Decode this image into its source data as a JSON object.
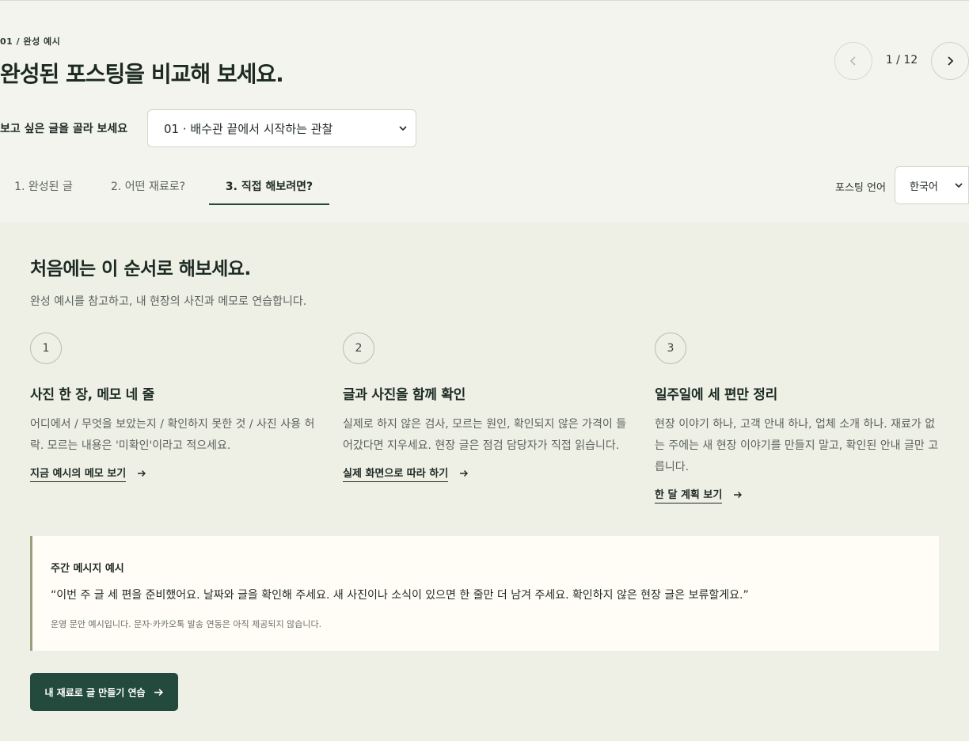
{
  "header": {
    "eyebrow": "01 / 완성 예시",
    "title": "완성된 포스팅을 비교해 보세요.",
    "pager": {
      "count": "1 / 12"
    },
    "picker": {
      "label": "보고 싶은 글을 골라 보세요",
      "selected": "01 · 배수관 끝에서 시작하는 관찰"
    }
  },
  "tabs": [
    {
      "label": "1. 완성된 글"
    },
    {
      "label": "2. 어떤 재료로?"
    },
    {
      "label": "3. 직접 해보려면?",
      "active": true
    }
  ],
  "language": {
    "label": "포스팅 언어",
    "selected": "한국어"
  },
  "section": {
    "title": "처음에는 이 순서로 해보세요.",
    "subtitle": "완성 예시를 참고하고, 내 현장의 사진과 메모로 연습합니다."
  },
  "steps": [
    {
      "num": "1",
      "title": "사진 한 장, 메모 네 줄",
      "desc": "어디에서 / 무엇을 보았는지 / 확인하지 못한 것 / 사진 사용 허락. 모르는 내용은 '미확인'이라고 적으세요.",
      "link": "지금 예시의 메모 보기"
    },
    {
      "num": "2",
      "title": "글과 사진을 함께 확인",
      "desc": "실제로 하지 않은 검사, 모르는 원인, 확인되지 않은 가격이 들어갔다면 지우세요. 현장 글은 점검 담당자가 직접 읽습니다.",
      "link": "실제 화면으로 따라 하기"
    },
    {
      "num": "3",
      "title": "일주일에 세 편만 정리",
      "desc": "현장 이야기 하나, 고객 안내 하나, 업체 소개 하나. 재료가 없는 주에는 새 현장 이야기를 만들지 말고, 확인된 안내 글만 고릅니다.",
      "link": "한 달 계획 보기"
    }
  ],
  "quote": {
    "title": "주간 메시지 예시",
    "body": "“이번 주 글 세 편을 준비했어요. 날짜와 글을 확인해 주세요. 새 사진이나 소식이 있으면 한 줄만 더 남겨 주세요. 확인하지 않은 현장 글은 보류할게요.”",
    "note": "운영 문안 예시입니다. 문자·카카오톡 발송 연동은 아직 제공되지 않습니다."
  },
  "cta": {
    "label": "내 재료로 글 만들기 연습"
  },
  "colors": {
    "accent": "#234a3d",
    "panel": "#eef0e6",
    "quote_bg": "#fffdf5",
    "quote_bar": "#9aa07e"
  }
}
